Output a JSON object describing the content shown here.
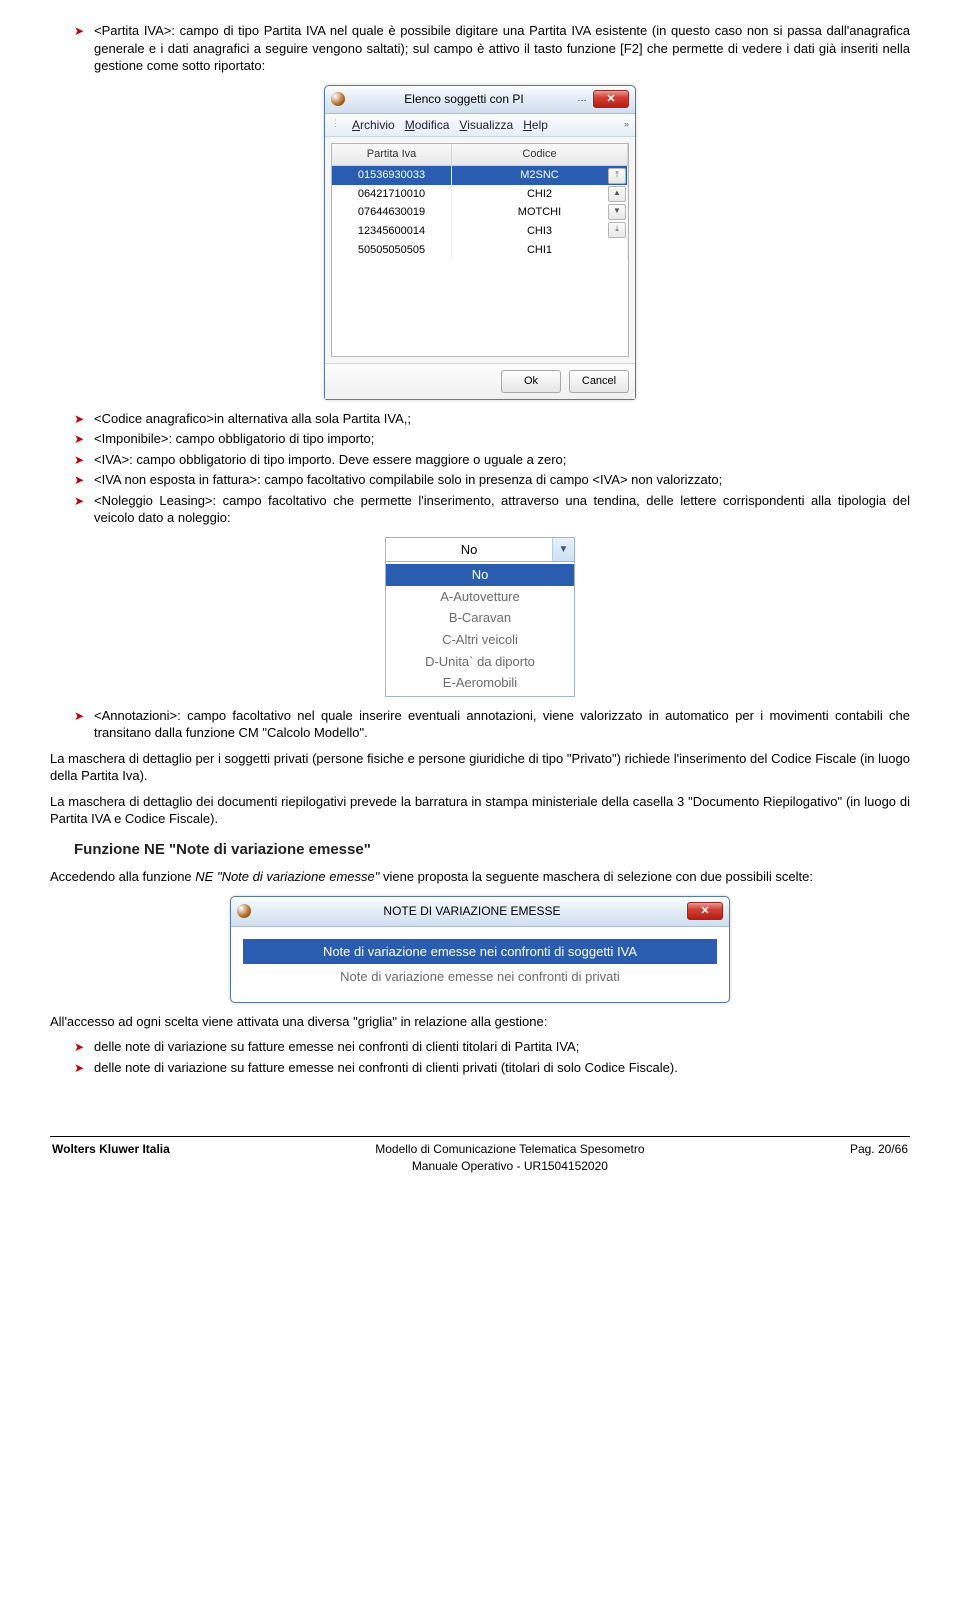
{
  "bullets1": {
    "b0": "<Partita IVA>: campo di tipo Partita IVA nel quale è possibile digitare una Partita IVA esistente (in questo caso non si passa dall'anagrafica generale e i dati anagrafici a seguire vengono saltati); sul campo è attivo il tasto funzione [F2] che permette di vedere i dati già inseriti nella gestione come sotto riportato:"
  },
  "win": {
    "title": "Elenco soggetti con PI",
    "menu": {
      "a": "Archivio",
      "m": "Modifica",
      "v": "Visualizza",
      "h": "Help"
    },
    "col1": "Partita Iva",
    "col2": "Codice",
    "rows": [
      {
        "piva": "01536930033",
        "cod": "M2SNC"
      },
      {
        "piva": "06421710010",
        "cod": "CHI2"
      },
      {
        "piva": "07644630019",
        "cod": "MOTCHI"
      },
      {
        "piva": "12345600014",
        "cod": "CHI3"
      },
      {
        "piva": "50505050505",
        "cod": "CHI1"
      }
    ],
    "ok": "Ok",
    "cancel": "Cancel"
  },
  "bullets2": {
    "b0": "<Codice anagrafico>in alternativa alla sola Partita IVA,;",
    "b1": "<Imponibile>: campo obbligatorio di tipo importo;",
    "b2": "<IVA>: campo obbligatorio di tipo importo. Deve essere maggiore o uguale a zero;",
    "b3": "<IVA non esposta in fattura>: campo facoltativo compilabile solo in presenza di campo <IVA> non valorizzato;",
    "b4": "<Noleggio Leasing>: campo facoltativo che permette l'inserimento, attraverso una tendina, delle lettere corrispondenti alla tipologia del veicolo dato a noleggio:"
  },
  "dropdown": {
    "selected": "No",
    "opts": [
      "No",
      "A-Autovetture",
      "B-Caravan",
      "C-Altri veicoli",
      "D-Unita` da diporto",
      "E-Aeromobili"
    ]
  },
  "bullets3": {
    "b0": "<Annotazioni>: campo facoltativo nel quale inserire eventuali annotazioni, viene valorizzato in automatico per i movimenti contabili che transitano dalla funzione CM \"Calcolo Modello\"."
  },
  "p1": "La maschera di dettaglio per i soggetti privati (persone fisiche e persone giuridiche di tipo \"Privato\") richiede l'inserimento del Codice Fiscale (in luogo della Partita Iva).",
  "p2": "La maschera di dettaglio dei documenti riepilogativi prevede la barratura in stampa ministeriale della casella 3 \"Documento Riepilogativo\" (in luogo di Partita IVA e Codice Fiscale).",
  "hdr": "Funzione NE \"Note di variazione emesse\"",
  "p3a": "Accedendo alla funzione ",
  "p3i": "NE \"Note di variazione emesse\"",
  "p3b": " viene proposta la seguente maschera di selezione con due possibili scelte:",
  "win2": {
    "title": "NOTE DI VARIAZIONE EMESSE",
    "opt1": "Note di variazione emesse nei confronti di soggetti IVA",
    "opt2": "Note di variazione emesse nei confronti di privati"
  },
  "p4": "All'accesso ad ogni scelta viene attivata una diversa \"griglia\" in relazione alla gestione:",
  "bullets4": {
    "b0": "delle note di variazione su fatture emesse nei confronti di clienti titolari di Partita IVA;",
    "b1": "delle note di variazione su fatture emesse nei confronti di clienti privati (titolari di solo Codice Fiscale)."
  },
  "footer": {
    "left": "Wolters Kluwer Italia",
    "center1": "Modello di Comunicazione Telematica Spesometro",
    "center2": "Manuale Operativo - UR1504152020",
    "right": "Pag. 20/66"
  }
}
